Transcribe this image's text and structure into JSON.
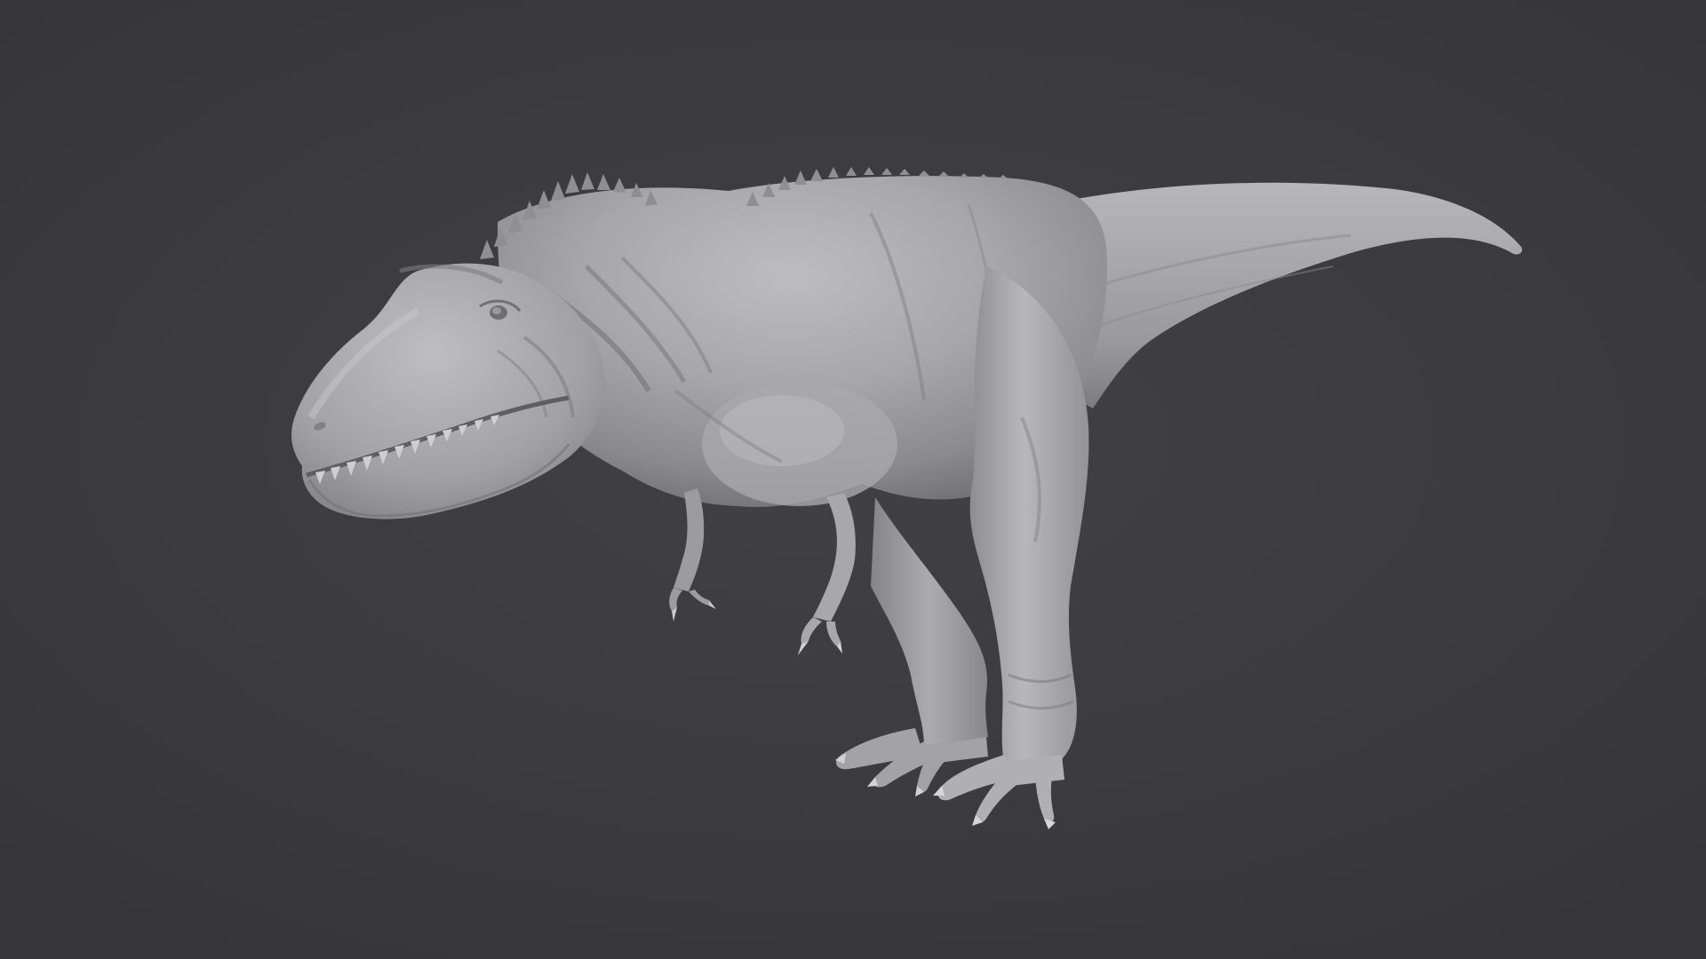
{
  "viewport": {
    "background_color": "#3b3b3d",
    "model": {
      "subject": "theropod-dinosaur-sculpt",
      "material": "matcap-clay",
      "base_color": "#a8a8aa",
      "highlight_color": "#c4c4c6",
      "shadow_color": "#6e6e70"
    }
  }
}
